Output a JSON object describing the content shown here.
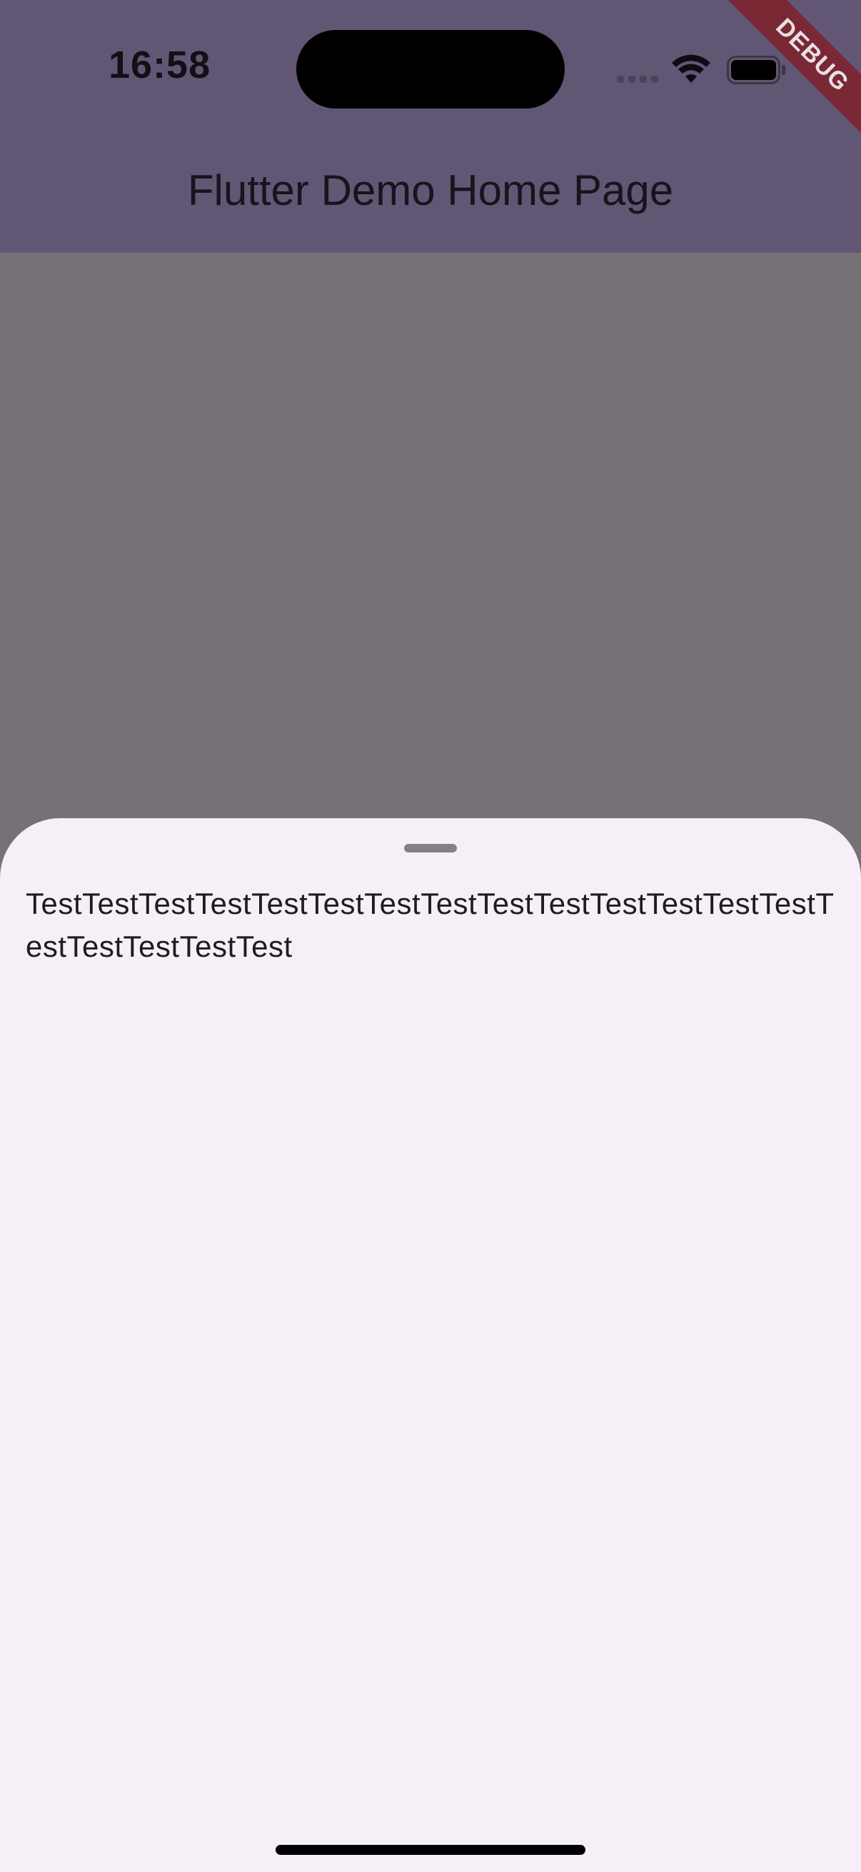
{
  "status_bar": {
    "time": "16:58"
  },
  "app_bar": {
    "title": "Flutter Demo Home Page"
  },
  "debug_banner": {
    "label": "DEBUG"
  },
  "bottom_sheet": {
    "text": "TestTestTestTestTestTestTestTestTestTestTestTestTestTestTestTestTestTestTest"
  },
  "icons": {
    "signal": "cellular-signal-icon",
    "wifi": "wifi-icon",
    "battery": "battery-icon"
  },
  "colors": {
    "app_bar": "#625675",
    "scrim_body": "#767176",
    "sheet_background": "#f6eff8",
    "debug_ribbon": "#7a2833"
  }
}
